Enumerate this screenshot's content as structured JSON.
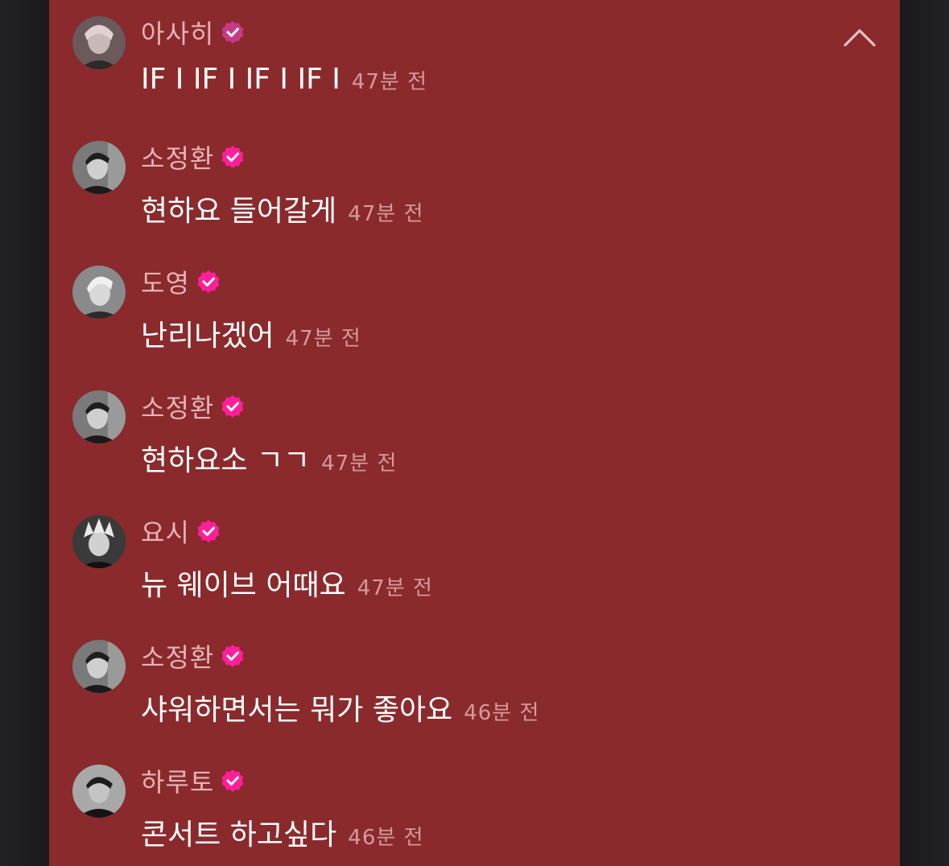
{
  "colors": {
    "panel": "#8a2a2c",
    "name": "#e6b4b6",
    "text": "#ffffff",
    "time": "#d49a9c",
    "verified": "#ff1f9a"
  },
  "collapse_icon": "chevron-up-icon",
  "messages": [
    {
      "name": "아사히",
      "text": "IF I IF I IF I IF I",
      "time": "47분 전",
      "avatar": "avatar-asahi"
    },
    {
      "name": "소정환",
      "text": "현하요 들어갈게",
      "time": "47분 전",
      "avatar": "avatar-junghwan"
    },
    {
      "name": "도영",
      "text": "난리나겠어",
      "time": "47분 전",
      "avatar": "avatar-doyoung"
    },
    {
      "name": "소정환",
      "text": "현하요소 ㄱㄱ",
      "time": "47분 전",
      "avatar": "avatar-junghwan"
    },
    {
      "name": "요시",
      "text": "뉴 웨이브 어때요",
      "time": "47분 전",
      "avatar": "avatar-yoshi"
    },
    {
      "name": "소정환",
      "text": "샤워하면서는 뭐가 좋아요",
      "time": "46분 전",
      "avatar": "avatar-junghwan"
    },
    {
      "name": "하루토",
      "text": "콘서트 하고싶다",
      "time": "46분 전",
      "avatar": "avatar-haruto"
    }
  ]
}
